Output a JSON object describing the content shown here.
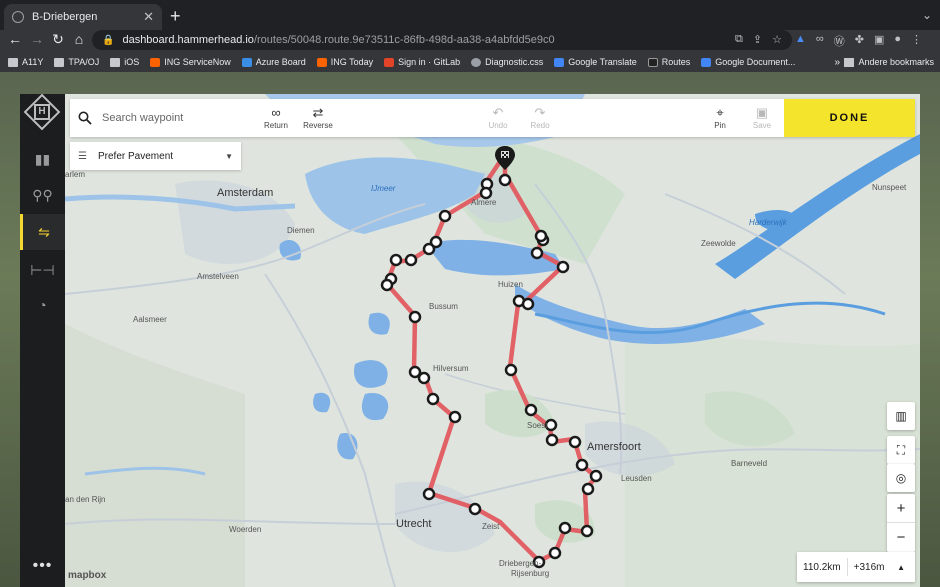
{
  "browser": {
    "tab_title": "B-Driebergen",
    "new_tab": "+",
    "url_host": "dashboard.hammerhead.io",
    "url_path": "/routes/50048.route.9e73511c-86fb-498d-aa38-a4abfdd5e9c0",
    "bookmarks": [
      {
        "label": "A11Y",
        "icon": "folder-icon"
      },
      {
        "label": "TPA/OJ",
        "icon": "folder-icon"
      },
      {
        "label": "iOS",
        "icon": "folder-icon"
      },
      {
        "label": "ING ServiceNow",
        "icon": "ing-icon"
      },
      {
        "label": "Azure Board",
        "icon": "azure-icon"
      },
      {
        "label": "ING Today",
        "icon": "ing-icon"
      },
      {
        "label": "Sign in · GitLab",
        "icon": "gitlab-icon"
      },
      {
        "label": "Diagnostic.css",
        "icon": "globe-icon"
      },
      {
        "label": "Google Translate",
        "icon": "translate-icon"
      },
      {
        "label": "Routes",
        "icon": "hammerhead-icon"
      },
      {
        "label": "Google Document...",
        "icon": "docs-icon"
      }
    ],
    "bookmarks_more": "»",
    "other_bookmarks": "Andere bookmarks"
  },
  "toolbar": {
    "search_placeholder": "Search waypoint",
    "return_label": "Return",
    "reverse_label": "Reverse",
    "undo_label": "Undo",
    "redo_label": "Redo",
    "pin_label": "Pin",
    "save_label": "Save",
    "done_label": "DONE"
  },
  "routing_preference": "Prefer Pavement",
  "route_stats": {
    "distance": "110.2km",
    "elevation": "+316m"
  },
  "map_labels": {
    "amsterdam": "Amsterdam",
    "ijmeer": "IJmeer",
    "almere": "Almere",
    "diemen": "Diemen",
    "amstelveen": "Amstelveen",
    "aalsmeer": "Aalsmeer",
    "bussum": "Bussum",
    "hilversum": "Hilversum",
    "huizen": "Huizen",
    "zeewolde": "Zeewolde",
    "harderwijk": "Harderwijk",
    "nunspeet": "Nunspeet",
    "soest": "Soest",
    "amersfoort": "Amersfoort",
    "leusden": "Leusden",
    "barneveld": "Barneveld",
    "utrecht": "Utrecht",
    "zeist": "Zeist",
    "woerden": "Woerden",
    "driebergen": "Driebergen-",
    "rijsenburg": "Rijsenburg",
    "alphen": "an den Rijn",
    "haarlem": "arlem",
    "mapbox": "mapbox"
  },
  "colors": {
    "route": "#e05a5f",
    "water": "#9dc3e8",
    "lake_dark": "#5a9ee0",
    "done": "#f5e42c",
    "sidebar_active": "#f5d731"
  }
}
